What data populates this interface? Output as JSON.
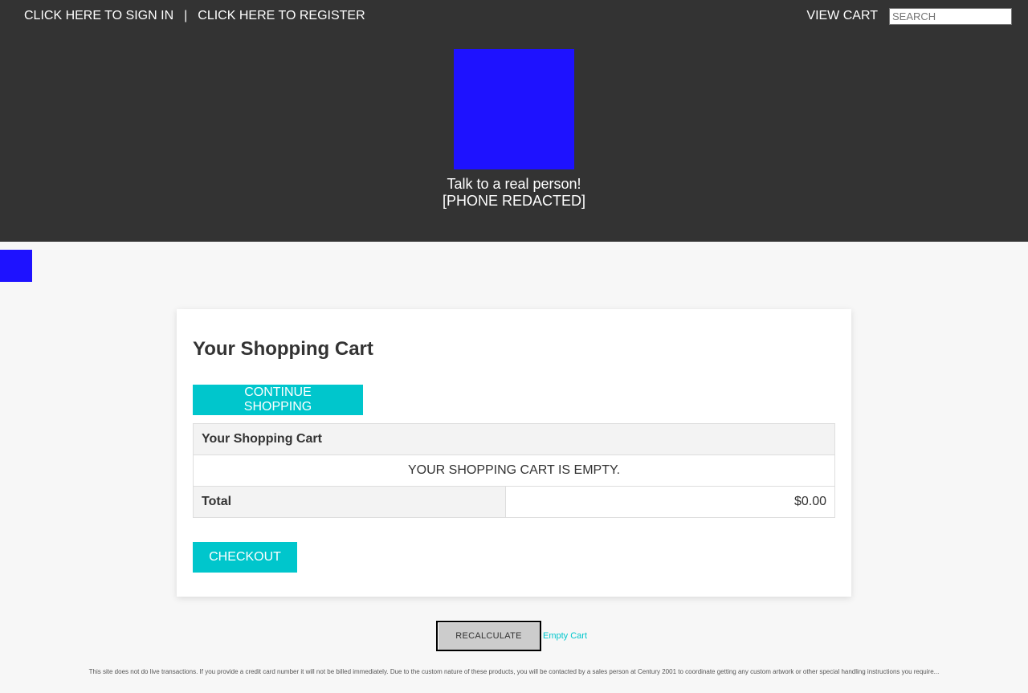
{
  "header": {
    "sign_in": "CLICK HERE TO SIGN IN",
    "separator": "|",
    "register": "CLICK HERE TO REGISTER",
    "view_cart": "VIEW CART",
    "search_placeholder": "SEARCH",
    "contact_line1": "Talk to a real person!",
    "contact_line2": "[PHONE REDACTED]"
  },
  "colors": {
    "header_bg": "#333333",
    "logo": "#1e12ff",
    "accent": "#00c6cc",
    "page_bg": "#f7f7f7"
  },
  "cart": {
    "title": "Your Shopping Cart",
    "continue_button": "CONTINUE SHOPPING",
    "table_header": "Your Shopping Cart",
    "empty_message": "YOUR SHOPPING CART IS EMPTY.",
    "total_label": "Total",
    "total_value": "$0.00",
    "checkout_button": "CHECKOUT"
  },
  "actions": {
    "recalculate": "RECALCULATE",
    "empty_cart": "Empty Cart"
  },
  "footer": {
    "disclaimer": "This site does not do live transactions. If you provide a credit card number it will not be billed immediately. Due to the custom nature of these products, you will be contacted by a sales person at Century 2001 to coordinate getting any custom artwork or other special handling instructions you require..."
  }
}
